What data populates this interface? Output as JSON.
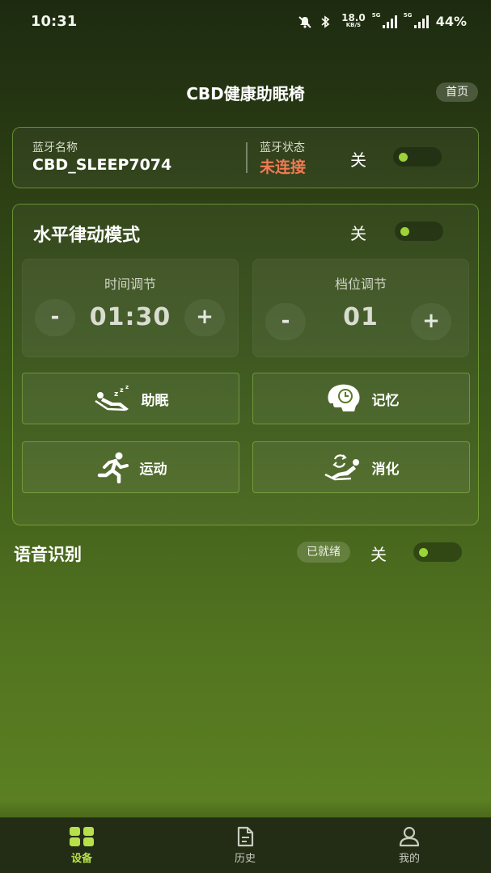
{
  "status_bar": {
    "time": "10:31",
    "net_speed_value": "18.0",
    "net_speed_unit": "KB/S",
    "signal1_tag": "5G",
    "signal2_tag": "5G",
    "battery": "44%"
  },
  "header": {
    "title": "CBD健康助眠椅",
    "home_button": "首页"
  },
  "bluetooth": {
    "name_label": "蓝牙名称",
    "name_value": "CBD_SLEEP7074",
    "state_label": "蓝牙状态",
    "state_value": "未连接",
    "switch_text": "关"
  },
  "mode": {
    "title": "水平律动模式",
    "switch_text": "关",
    "time_adjust": {
      "label": "时间调节",
      "minus": "-",
      "value": "01:30",
      "plus": "+"
    },
    "level_adjust": {
      "label": "档位调节",
      "minus": "-",
      "value": "01",
      "plus": "+"
    },
    "functions": [
      {
        "label": "助眠",
        "icon": "sleep-recline-icon"
      },
      {
        "label": "记忆",
        "icon": "memory-head-clock-icon"
      },
      {
        "label": "运动",
        "icon": "running-person-icon"
      },
      {
        "label": "消化",
        "icon": "digest-recline-icon"
      }
    ]
  },
  "voice": {
    "title": "语音识别",
    "badge": "已就绪",
    "switch_text": "关"
  },
  "bottom_nav": {
    "items": [
      {
        "label": "设备",
        "icon": "grid-icon",
        "active": true
      },
      {
        "label": "历史",
        "icon": "document-icon",
        "active": false
      },
      {
        "label": "我的",
        "icon": "person-icon",
        "active": false
      }
    ]
  },
  "colors": {
    "accent": "#9cd23a",
    "nav_active": "#b8e04a",
    "disconnected": "#f27a55"
  }
}
